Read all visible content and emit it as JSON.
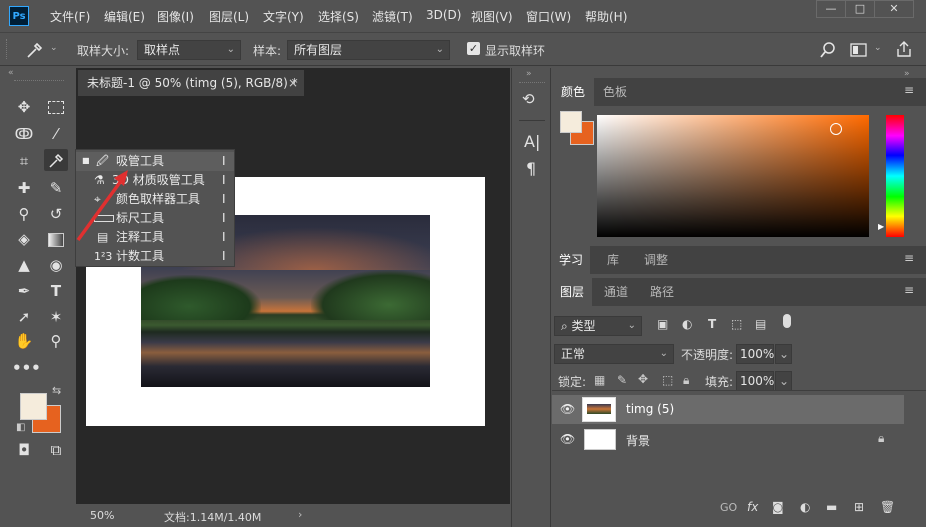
{
  "app": {
    "logo": "Ps",
    "menu": [
      "文件(F)",
      "编辑(E)",
      "图像(I)",
      "图层(L)",
      "文字(Y)",
      "选择(S)",
      "滤镜(T)",
      "3D(D)",
      "视图(V)",
      "窗口(W)",
      "帮助(H)"
    ],
    "window_controls": [
      "—",
      "□",
      "✕"
    ]
  },
  "options": {
    "sample_size_label": "取样大小:",
    "sample_size_value": "取样点",
    "sample_label": "样本:",
    "sample_value": "所有图层",
    "show_ring_label": "显示取样环",
    "show_ring_checked": true
  },
  "document": {
    "tab_title": "未标题-1 @ 50% (timg (5), RGB/8) *",
    "tab_close": "×",
    "zoom": "50%",
    "doc_info": "文档:1.14M/1.40M",
    "status_arrow": "›"
  },
  "flyout": {
    "items": [
      {
        "label": "吸管工具",
        "shortcut": "I",
        "selected": true
      },
      {
        "label": "3D 材质吸管工具",
        "shortcut": "I"
      },
      {
        "label": "颜色取样器工具",
        "shortcut": "I"
      },
      {
        "label": "标尺工具",
        "shortcut": "I"
      },
      {
        "label": "注释工具",
        "shortcut": "I"
      },
      {
        "label": "计数工具",
        "shortcut": "I"
      }
    ],
    "count_glyph": "1²3"
  },
  "panels": {
    "color_tabs": [
      "颜色",
      "色板"
    ],
    "learn_tabs": [
      "学习",
      "库",
      "调整"
    ],
    "layer_tabs": [
      "图层",
      "通道",
      "路径"
    ],
    "filter_kind": "类型",
    "blend_mode": "正常",
    "opacity_label": "不透明度:",
    "opacity_value": "100%",
    "lock_label": "锁定:",
    "fill_label": "填充:",
    "fill_value": "100%",
    "layers": [
      {
        "name": "timg (5)",
        "selected": true
      },
      {
        "name": "背景",
        "locked": true
      }
    ],
    "bottom_icons": [
      "GO",
      "fx"
    ]
  },
  "colors": {
    "foreground": "#f5ecdc",
    "background": "#e6621f",
    "hue_base": "#ff6a00"
  }
}
